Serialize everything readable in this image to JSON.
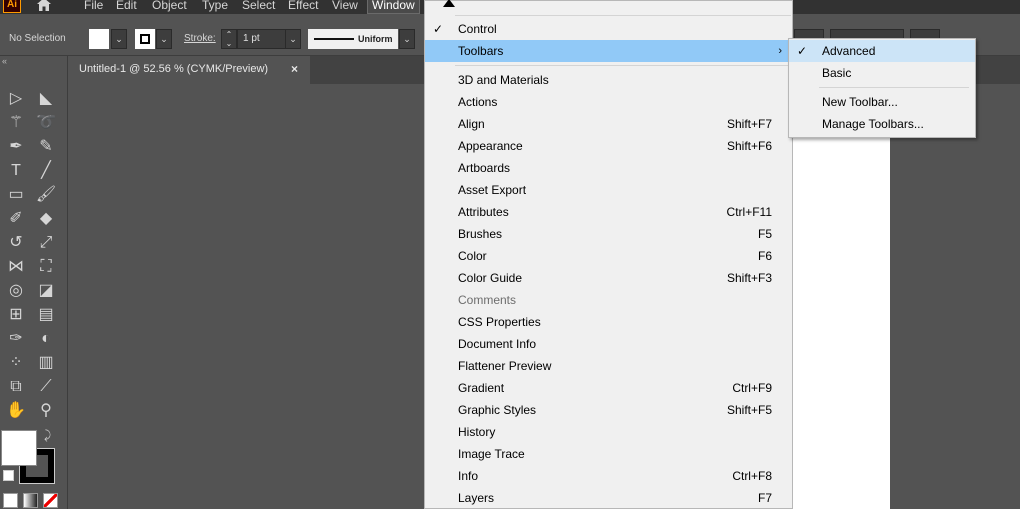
{
  "app": {
    "logo_text": "Ai",
    "accent": "#ff9a00"
  },
  "menubar": {
    "items": [
      "File",
      "Edit",
      "Object",
      "Type",
      "Select",
      "Effect",
      "View",
      "Window"
    ],
    "active": "Window"
  },
  "control": {
    "selection_label": "No Selection",
    "stroke_label": "Stroke:",
    "stroke_weight": "1 pt",
    "profile_label": "Uniform"
  },
  "document_tab": {
    "title": "Untitled-1 @ 52.56 % (CYMK/Preview)",
    "close_glyph": "×"
  },
  "window_menu": {
    "items": [
      {
        "label": "Control",
        "shortcut": "",
        "checked": true,
        "highlighted": false,
        "disabled": false
      },
      {
        "label": "Toolbars",
        "shortcut": "",
        "checked": false,
        "highlighted": true,
        "disabled": false,
        "submenu": true
      },
      {
        "label": "3D and Materials",
        "shortcut": ""
      },
      {
        "label": "Actions",
        "shortcut": ""
      },
      {
        "label": "Align",
        "shortcut": "Shift+F7"
      },
      {
        "label": "Appearance",
        "shortcut": "Shift+F6"
      },
      {
        "label": "Artboards",
        "shortcut": ""
      },
      {
        "label": "Asset Export",
        "shortcut": ""
      },
      {
        "label": "Attributes",
        "shortcut": "Ctrl+F11"
      },
      {
        "label": "Brushes",
        "shortcut": "F5"
      },
      {
        "label": "Color",
        "shortcut": "F6"
      },
      {
        "label": "Color Guide",
        "shortcut": "Shift+F3"
      },
      {
        "label": "Comments",
        "shortcut": "",
        "disabled": true
      },
      {
        "label": "CSS Properties",
        "shortcut": ""
      },
      {
        "label": "Document Info",
        "shortcut": ""
      },
      {
        "label": "Flattener Preview",
        "shortcut": ""
      },
      {
        "label": "Gradient",
        "shortcut": "Ctrl+F9"
      },
      {
        "label": "Graphic Styles",
        "shortcut": "Shift+F5"
      },
      {
        "label": "History",
        "shortcut": ""
      },
      {
        "label": "Image Trace",
        "shortcut": ""
      },
      {
        "label": "Info",
        "shortcut": "Ctrl+F8"
      },
      {
        "label": "Layers",
        "shortcut": "F7"
      }
    ]
  },
  "toolbars_submenu": {
    "items": [
      {
        "label": "Advanced",
        "checked": true
      },
      {
        "label": "Basic",
        "checked": false
      },
      {
        "label": "New Toolbar...",
        "checked": false
      },
      {
        "label": "Manage Toolbars...",
        "checked": false
      }
    ]
  },
  "tools": [
    "selection-tool-icon",
    "direct-selection-tool-icon",
    "magic-wand-tool-icon",
    "lasso-tool-icon",
    "pen-tool-icon",
    "curvature-tool-icon",
    "type-tool-icon",
    "line-segment-tool-icon",
    "rectangle-tool-icon",
    "paintbrush-tool-icon",
    "shaper-tool-icon",
    "eraser-tool-icon",
    "rotate-tool-icon",
    "scale-tool-icon",
    "width-tool-icon",
    "free-transform-tool-icon",
    "shape-builder-tool-icon",
    "perspective-grid-tool-icon",
    "mesh-tool-icon",
    "gradient-tool-icon",
    "eyedropper-tool-icon",
    "blend-tool-icon",
    "symbol-sprayer-tool-icon",
    "column-graph-tool-icon",
    "artboard-tool-icon",
    "slice-tool-icon",
    "hand-tool-icon",
    "zoom-tool-icon"
  ]
}
